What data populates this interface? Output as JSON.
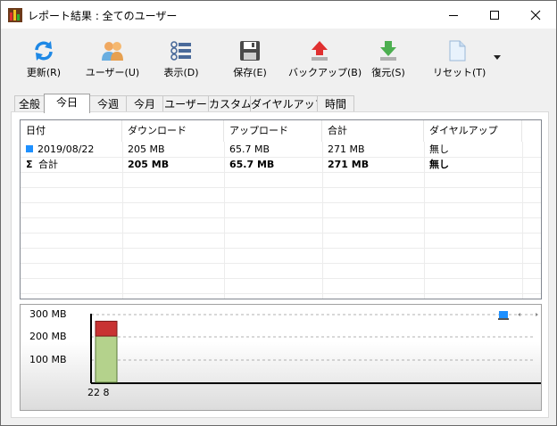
{
  "window": {
    "title": "レポート結果 : 全てのユーザー"
  },
  "toolbar": {
    "refresh": "更新(R)",
    "users": "ユーザー(U)",
    "view": "表示(D)",
    "save": "保存(E)",
    "backup": "バックアップ(B)",
    "restore": "復元(S)",
    "reset": "リセット(T)"
  },
  "tabs": [
    "全般",
    "今日",
    "今週",
    "今月",
    "ユーザー",
    "カスタム",
    "ダイヤルアップ",
    "時間"
  ],
  "active_tab": "今日",
  "table": {
    "headers": [
      "日付",
      "ダウンロード",
      "アップロード",
      "合計",
      "ダイヤルアップ"
    ],
    "rows": [
      [
        "2019/08/22",
        "205 MB",
        "65.7 MB",
        "271 MB",
        "無し"
      ]
    ],
    "total_row": [
      "合計",
      "205 MB",
      "65.7 MB",
      "271 MB",
      "無し"
    ]
  },
  "colors": {
    "row_marker": "#1e90ff",
    "upload_bar": "#c83232",
    "download_bar": "#b4d28c"
  },
  "chart_data": {
    "type": "bar",
    "categories": [
      "22 8"
    ],
    "series": [
      {
        "values": [
          205
        ]
      },
      {
        "values": [
          65.7
        ]
      }
    ],
    "stacked": true,
    "yticks": [
      "100 MB",
      "200 MB",
      "300 MB"
    ],
    "ylim": [
      0,
      300
    ],
    "grid": true
  }
}
